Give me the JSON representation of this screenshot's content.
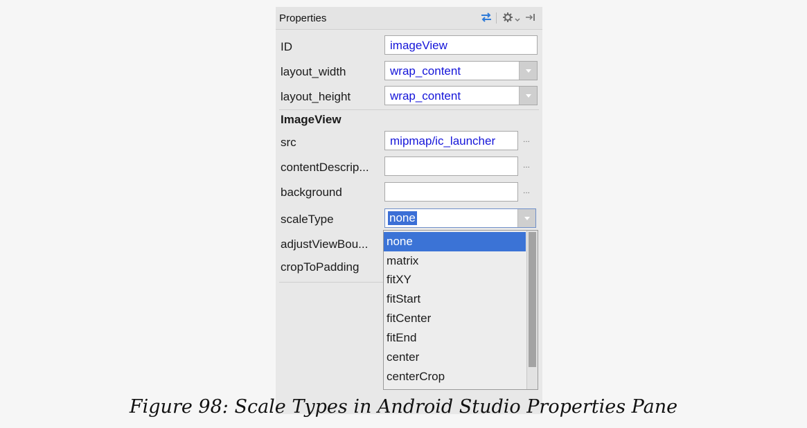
{
  "pane": {
    "title": "Properties",
    "header_icons": [
      "swap-arrows-icon",
      "gear-icon",
      "chevron-down-icon",
      "pin-to-side-icon"
    ]
  },
  "rows": {
    "id": {
      "label": "ID",
      "value": "imageView"
    },
    "layout_width": {
      "label": "layout_width",
      "value": "wrap_content"
    },
    "layout_height": {
      "label": "layout_height",
      "value": "wrap_content"
    },
    "section": "ImageView",
    "src": {
      "label": "src",
      "value": "mipmap/ic_launcher",
      "more": "..."
    },
    "contentDescription": {
      "label": "contentDescrip...",
      "value": "",
      "more": "..."
    },
    "background": {
      "label": "background",
      "value": "",
      "more": "..."
    },
    "scaleType": {
      "label": "scaleType",
      "value": "none"
    },
    "adjustViewBounds": {
      "label": "adjustViewBou..."
    },
    "cropToPadding": {
      "label": "cropToPadding"
    }
  },
  "scale_options": [
    "none",
    "matrix",
    "fitXY",
    "fitStart",
    "fitCenter",
    "fitEnd",
    "center",
    "centerCrop"
  ],
  "selected_option": "none",
  "caption": "Figure 98: Scale Types in Android Studio Properties Pane",
  "colors": {
    "value_text": "#1414d9",
    "selection": "#3b73d6",
    "pane_background": "#e8e8e8"
  }
}
